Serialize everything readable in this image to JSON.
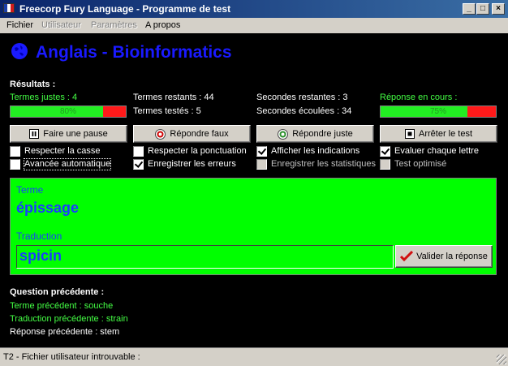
{
  "window": {
    "title": "Freecorp Fury Language - Programme de test",
    "minimize": "_",
    "maximize": "□",
    "close": "×"
  },
  "menu": {
    "items": [
      {
        "label": "Fichier",
        "enabled": true
      },
      {
        "label": "Utilisateur",
        "enabled": false
      },
      {
        "label": "Paramètres",
        "enabled": false
      },
      {
        "label": "A propos",
        "enabled": true
      }
    ]
  },
  "header": {
    "title": "Anglais - Bioinformatics"
  },
  "stats": {
    "results_label": "Résultats :",
    "correct_terms": "Termes justes : 4",
    "correct_progress_text": "80%",
    "correct_progress": 0.8,
    "remaining_terms": "Termes restants : 44",
    "tested_terms": "Termes testés : 5",
    "remaining_seconds": "Secondes restantes : 3",
    "elapsed_seconds": "Secondes écoulées : 34",
    "current_answer": "Réponse en cours :",
    "current_progress_text": "75%",
    "current_progress": 0.75
  },
  "buttons": {
    "pause": "Faire une pause",
    "answer_wrong": "Répondre faux",
    "answer_right": "Répondre juste",
    "stop": "Arrêter le test",
    "validate": "Valider la réponse"
  },
  "options": [
    {
      "label": "Respecter la casse",
      "checked": false,
      "enabled": true
    },
    {
      "label": "Respecter la ponctuation",
      "checked": false,
      "enabled": true
    },
    {
      "label": "Afficher les indications",
      "checked": true,
      "enabled": true
    },
    {
      "label": "Evaluer chaque lettre",
      "checked": true,
      "enabled": true
    },
    {
      "label": "Avancée automatique",
      "checked": false,
      "enabled": true
    },
    {
      "label": "Enregistrer les erreurs",
      "checked": true,
      "enabled": true
    },
    {
      "label": "Enregistrer les statistiques",
      "checked": false,
      "enabled": false
    },
    {
      "label": "Test optimisé",
      "checked": false,
      "enabled": false
    }
  ],
  "question": {
    "term_label": "Terme",
    "term_value": "épissage",
    "translation_label": "Traduction",
    "translation_value": "spicin"
  },
  "previous": {
    "heading": "Question précédente :",
    "term": "Terme précédent : souche",
    "translation": "Traduction précédente : strain",
    "answer": "Réponse précédente : stem"
  },
  "status": {
    "text": "T2 - Fichier utilisateur introuvable :"
  },
  "colors": {
    "accent_green": "#00ff00",
    "title_blue": "#1a1aff",
    "progress_red": "#ff1a1a"
  }
}
